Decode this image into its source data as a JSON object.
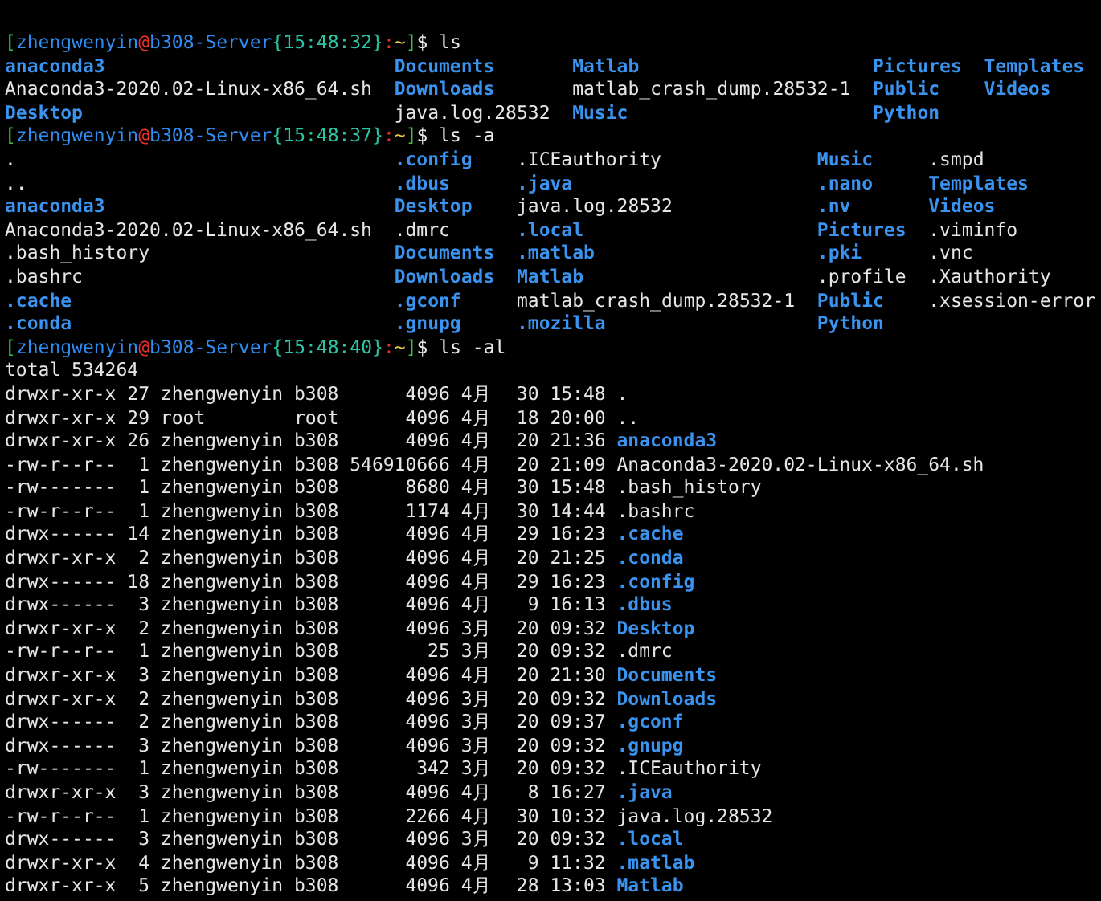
{
  "terminal": {
    "lines": [
      {
        "kind": "prompt",
        "segments": [
          {
            "text": "[",
            "color": "#3ec43e"
          },
          {
            "text": "zhengwenyin",
            "color": "#2f8cf0"
          },
          {
            "text": "@",
            "color": "#e8312b"
          },
          {
            "text": "b308-Server",
            "color": "#2f8cf0"
          },
          {
            "text": "{15:48:32}",
            "color": "#2cc4a4"
          },
          {
            "text": ":",
            "color": "#e8312b"
          },
          {
            "text": "~",
            "color": "#e8c84a"
          },
          {
            "text": "]",
            "color": "#3ec43e"
          },
          {
            "text": "$ ls",
            "color": "#ececec"
          }
        ]
      },
      {
        "kind": "columns",
        "columns": [
          [
            {
              "name": "anaconda3",
              "kind": "dir"
            },
            {
              "name": "Anaconda3-2020.02-Linux-x86_64.sh",
              "kind": "file"
            },
            {
              "name": "Desktop",
              "kind": "dir"
            }
          ],
          [
            {
              "name": "Documents",
              "kind": "dir"
            },
            {
              "name": "Downloads",
              "kind": "dir"
            },
            {
              "name": "java.log.28532",
              "kind": "file"
            }
          ],
          [
            {
              "name": "Matlab",
              "kind": "dir"
            },
            {
              "name": "matlab_crash_dump.28532-1",
              "kind": "file"
            },
            {
              "name": "Music",
              "kind": "dir"
            }
          ],
          [
            {
              "name": "Pictures",
              "kind": "dir"
            },
            {
              "name": "Public",
              "kind": "dir"
            },
            {
              "name": "Python",
              "kind": "dir"
            }
          ],
          [
            {
              "name": "Templates",
              "kind": "dir"
            },
            {
              "name": "Videos",
              "kind": "dir"
            }
          ]
        ]
      },
      {
        "kind": "prompt",
        "segments": [
          {
            "text": "[",
            "color": "#3ec43e"
          },
          {
            "text": "zhengwenyin",
            "color": "#2f8cf0"
          },
          {
            "text": "@",
            "color": "#e8312b"
          },
          {
            "text": "b308-Server",
            "color": "#2f8cf0"
          },
          {
            "text": "{15:48:37}",
            "color": "#2cc4a4"
          },
          {
            "text": ":",
            "color": "#e8312b"
          },
          {
            "text": "~",
            "color": "#e8c84a"
          },
          {
            "text": "]",
            "color": "#3ec43e"
          },
          {
            "text": "$ ls -a",
            "color": "#ececec"
          }
        ]
      },
      {
        "kind": "columns",
        "columns": [
          [
            {
              "name": ".",
              "kind": "file"
            },
            {
              "name": "..",
              "kind": "file"
            },
            {
              "name": "anaconda3",
              "kind": "dir"
            },
            {
              "name": "Anaconda3-2020.02-Linux-x86_64.sh",
              "kind": "file"
            },
            {
              "name": ".bash_history",
              "kind": "file"
            },
            {
              "name": ".bashrc",
              "kind": "file"
            },
            {
              "name": ".cache",
              "kind": "dir"
            },
            {
              "name": ".conda",
              "kind": "dir"
            }
          ],
          [
            {
              "name": ".config",
              "kind": "dir"
            },
            {
              "name": ".dbus",
              "kind": "dir"
            },
            {
              "name": "Desktop",
              "kind": "dir"
            },
            {
              "name": ".dmrc",
              "kind": "file"
            },
            {
              "name": "Documents",
              "kind": "dir"
            },
            {
              "name": "Downloads",
              "kind": "dir"
            },
            {
              "name": ".gconf",
              "kind": "dir"
            },
            {
              "name": ".gnupg",
              "kind": "dir"
            }
          ],
          [
            {
              "name": ".ICEauthority",
              "kind": "file"
            },
            {
              "name": ".java",
              "kind": "dir"
            },
            {
              "name": "java.log.28532",
              "kind": "file"
            },
            {
              "name": ".local",
              "kind": "dir"
            },
            {
              "name": ".matlab",
              "kind": "dir"
            },
            {
              "name": "Matlab",
              "kind": "dir"
            },
            {
              "name": "matlab_crash_dump.28532-1",
              "kind": "file"
            },
            {
              "name": ".mozilla",
              "kind": "dir"
            }
          ],
          [
            {
              "name": "Music",
              "kind": "dir"
            },
            {
              "name": ".nano",
              "kind": "dir"
            },
            {
              "name": ".nv",
              "kind": "dir"
            },
            {
              "name": "Pictures",
              "kind": "dir"
            },
            {
              "name": ".pki",
              "kind": "dir"
            },
            {
              "name": ".profile",
              "kind": "file"
            },
            {
              "name": "Public",
              "kind": "dir"
            },
            {
              "name": "Python",
              "kind": "dir"
            }
          ],
          [
            {
              "name": ".smpd",
              "kind": "file"
            },
            {
              "name": "Templates",
              "kind": "dir"
            },
            {
              "name": "Videos",
              "kind": "dir"
            },
            {
              "name": ".viminfo",
              "kind": "file"
            },
            {
              "name": ".vnc",
              "kind": "file"
            },
            {
              "name": ".Xauthority",
              "kind": "file"
            },
            {
              "name": ".xsession-error",
              "kind": "file"
            }
          ]
        ]
      },
      {
        "kind": "prompt",
        "segments": [
          {
            "text": "[",
            "color": "#3ec43e"
          },
          {
            "text": "zhengwenyin",
            "color": "#2f8cf0"
          },
          {
            "text": "@",
            "color": "#e8312b"
          },
          {
            "text": "b308-Server",
            "color": "#2f8cf0"
          },
          {
            "text": "{15:48:40}",
            "color": "#2cc4a4"
          },
          {
            "text": ":",
            "color": "#e8312b"
          },
          {
            "text": "~",
            "color": "#e8c84a"
          },
          {
            "text": "]",
            "color": "#3ec43e"
          },
          {
            "text": "$ ls -al",
            "color": "#ececec"
          }
        ]
      },
      {
        "kind": "text",
        "text": "total 534264"
      },
      {
        "kind": "listing",
        "rows": [
          {
            "permissions": "drwxr-xr-x",
            "links": "27",
            "owner": "zhengwenyin",
            "group": "b308",
            "size": "4096",
            "month": "4月",
            "day": "30",
            "time": "15:48",
            "name": ".",
            "kind": "file"
          },
          {
            "permissions": "drwxr-xr-x",
            "links": "29",
            "owner": "root",
            "group": "root",
            "size": "4096",
            "month": "4月",
            "day": "18",
            "time": "20:00",
            "name": "..",
            "kind": "file"
          },
          {
            "permissions": "drwxr-xr-x",
            "links": "26",
            "owner": "zhengwenyin",
            "group": "b308",
            "size": "4096",
            "month": "4月",
            "day": "20",
            "time": "21:36",
            "name": "anaconda3",
            "kind": "dir"
          },
          {
            "permissions": "-rw-r--r--",
            "links": "1",
            "owner": "zhengwenyin",
            "group": "b308",
            "size": "546910666",
            "month": "4月",
            "day": "20",
            "time": "21:09",
            "name": "Anaconda3-2020.02-Linux-x86_64.sh",
            "kind": "file"
          },
          {
            "permissions": "-rw-------",
            "links": "1",
            "owner": "zhengwenyin",
            "group": "b308",
            "size": "8680",
            "month": "4月",
            "day": "30",
            "time": "15:48",
            "name": ".bash_history",
            "kind": "file"
          },
          {
            "permissions": "-rw-r--r--",
            "links": "1",
            "owner": "zhengwenyin",
            "group": "b308",
            "size": "1174",
            "month": "4月",
            "day": "30",
            "time": "14:44",
            "name": ".bashrc",
            "kind": "file"
          },
          {
            "permissions": "drwx------",
            "links": "14",
            "owner": "zhengwenyin",
            "group": "b308",
            "size": "4096",
            "month": "4月",
            "day": "29",
            "time": "16:23",
            "name": ".cache",
            "kind": "dir"
          },
          {
            "permissions": "drwxr-xr-x",
            "links": "2",
            "owner": "zhengwenyin",
            "group": "b308",
            "size": "4096",
            "month": "4月",
            "day": "20",
            "time": "21:25",
            "name": ".conda",
            "kind": "dir"
          },
          {
            "permissions": "drwx------",
            "links": "18",
            "owner": "zhengwenyin",
            "group": "b308",
            "size": "4096",
            "month": "4月",
            "day": "29",
            "time": "16:23",
            "name": ".config",
            "kind": "dir"
          },
          {
            "permissions": "drwx------",
            "links": "3",
            "owner": "zhengwenyin",
            "group": "b308",
            "size": "4096",
            "month": "4月",
            "day": "9",
            "time": "16:13",
            "name": ".dbus",
            "kind": "dir"
          },
          {
            "permissions": "drwxr-xr-x",
            "links": "2",
            "owner": "zhengwenyin",
            "group": "b308",
            "size": "4096",
            "month": "3月",
            "day": "20",
            "time": "09:32",
            "name": "Desktop",
            "kind": "dir"
          },
          {
            "permissions": "-rw-r--r--",
            "links": "1",
            "owner": "zhengwenyin",
            "group": "b308",
            "size": "25",
            "month": "3月",
            "day": "20",
            "time": "09:32",
            "name": ".dmrc",
            "kind": "file"
          },
          {
            "permissions": "drwxr-xr-x",
            "links": "3",
            "owner": "zhengwenyin",
            "group": "b308",
            "size": "4096",
            "month": "4月",
            "day": "20",
            "time": "21:30",
            "name": "Documents",
            "kind": "dir"
          },
          {
            "permissions": "drwxr-xr-x",
            "links": "2",
            "owner": "zhengwenyin",
            "group": "b308",
            "size": "4096",
            "month": "3月",
            "day": "20",
            "time": "09:32",
            "name": "Downloads",
            "kind": "dir"
          },
          {
            "permissions": "drwx------",
            "links": "2",
            "owner": "zhengwenyin",
            "group": "b308",
            "size": "4096",
            "month": "3月",
            "day": "20",
            "time": "09:37",
            "name": ".gconf",
            "kind": "dir"
          },
          {
            "permissions": "drwx------",
            "links": "3",
            "owner": "zhengwenyin",
            "group": "b308",
            "size": "4096",
            "month": "3月",
            "day": "20",
            "time": "09:32",
            "name": ".gnupg",
            "kind": "dir"
          },
          {
            "permissions": "-rw-------",
            "links": "1",
            "owner": "zhengwenyin",
            "group": "b308",
            "size": "342",
            "month": "3月",
            "day": "20",
            "time": "09:32",
            "name": ".ICEauthority",
            "kind": "file"
          },
          {
            "permissions": "drwxr-xr-x",
            "links": "3",
            "owner": "zhengwenyin",
            "group": "b308",
            "size": "4096",
            "month": "4月",
            "day": "8",
            "time": "16:27",
            "name": ".java",
            "kind": "dir"
          },
          {
            "permissions": "-rw-r--r--",
            "links": "1",
            "owner": "zhengwenyin",
            "group": "b308",
            "size": "2266",
            "month": "4月",
            "day": "30",
            "time": "10:32",
            "name": "java.log.28532",
            "kind": "file"
          },
          {
            "permissions": "drwx------",
            "links": "3",
            "owner": "zhengwenyin",
            "group": "b308",
            "size": "4096",
            "month": "3月",
            "day": "20",
            "time": "09:32",
            "name": ".local",
            "kind": "dir"
          },
          {
            "permissions": "drwxr-xr-x",
            "links": "4",
            "owner": "zhengwenyin",
            "group": "b308",
            "size": "4096",
            "month": "4月",
            "day": "9",
            "time": "11:32",
            "name": ".matlab",
            "kind": "dir"
          },
          {
            "permissions": "drwxr-xr-x",
            "links": "5",
            "owner": "zhengwenyin",
            "group": "b308",
            "size": "4096",
            "month": "4月",
            "day": "28",
            "time": "13:03",
            "name": "Matlab",
            "kind": "dir"
          }
        ]
      }
    ]
  }
}
